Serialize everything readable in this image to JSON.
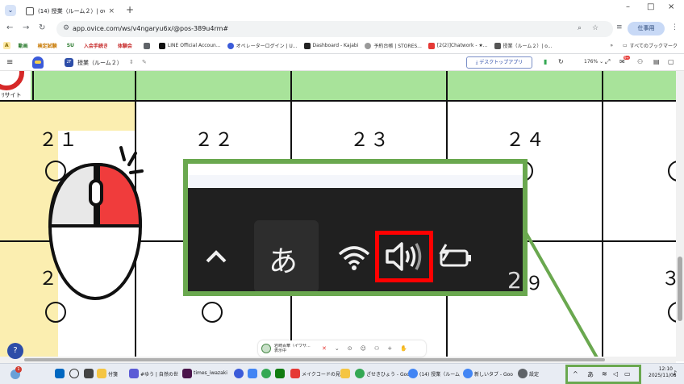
{
  "browser": {
    "tab_menu_icon": "chevron-down-icon",
    "tab_title": "(14) 授業（ルーム２）| ovice",
    "tab_close": "×",
    "new_tab": "+",
    "window_controls": [
      "–",
      "□",
      "×"
    ],
    "address": "app.ovice.com/ws/v4ngaryu6x/@pos-389u4rm#",
    "profile_label": "仕事用"
  },
  "bookmarks": {
    "items": [
      {
        "label": "A",
        "chip": true,
        "color": "#f5c542"
      },
      {
        "label": "動画",
        "chip": true,
        "color": "#4caf50"
      },
      {
        "label": "検定試験",
        "chip": true,
        "color": "#f4a742"
      },
      {
        "label": "SU",
        "chip": true,
        "color": "#3a7d44"
      },
      {
        "label": "入会手続き",
        "chip": true,
        "color": "#e53935"
      },
      {
        "label": "体験会",
        "chip": true,
        "color": "#e53935"
      },
      {
        "label": "LINE Official Accoun...",
        "chip": false,
        "color": "#111111"
      },
      {
        "label": "オペレーターログイン | U...",
        "chip": false,
        "color": "#3b5bd9"
      },
      {
        "label": "Dashboard - Kajabi",
        "chip": false,
        "color": "#222222"
      },
      {
        "label": "予約台帳 | STORES...",
        "chip": false,
        "color": "#888888"
      },
      {
        "label": "[2(2)]Chatwork - ★...",
        "chip": false,
        "color": "#e53935"
      },
      {
        "label": "授業（ルーム２）| o...",
        "chip": false,
        "color": "#555555"
      }
    ],
    "more": "»",
    "all_bookmarks": "すべてのブックマーク"
  },
  "app": {
    "floor_badge": "2F",
    "room_name": "授業（ルーム２）",
    "desktop_app_button": "デスクトップアプリ",
    "zoom_level": "176%",
    "notification_count": "9+"
  },
  "board": {
    "column_numbers": [
      "２１",
      "２２",
      "２３",
      "２４"
    ],
    "row2_partial_numbers": [
      "２",
      "２９",
      "３"
    ],
    "logo_text": "ﾘサイト"
  },
  "callout": {
    "ime_char": "あ",
    "chevron": "^",
    "partial_digits": "29",
    "highlight_color": "#ff0000",
    "frame_color": "#6aa84f"
  },
  "ovice_bar": {
    "user_name": "岩崎百華（イワサ...",
    "user_status": "表示中"
  },
  "taskbar": {
    "weather_badge": "1",
    "items": [
      {
        "label": "付箋",
        "color": "#f5c542"
      },
      {
        "label": "#ゆう | 自然の世",
        "color": "#5b5bd6"
      },
      {
        "label": "times_iwazaki",
        "color": "#4a154b"
      },
      {
        "label": "メイクコードの見",
        "color": "#e53935"
      },
      {
        "label": "ざせきひょう - Goo",
        "color": "#34a853"
      },
      {
        "label": "(14) 授業（ルーム",
        "color": "#4285f4"
      },
      {
        "label": "新しいタブ - Goo",
        "color": "#4285f4"
      },
      {
        "label": "設定",
        "color": "#5f6368"
      }
    ],
    "tray_ime": "あ",
    "time": "12:10",
    "date": "2025/11/08"
  }
}
